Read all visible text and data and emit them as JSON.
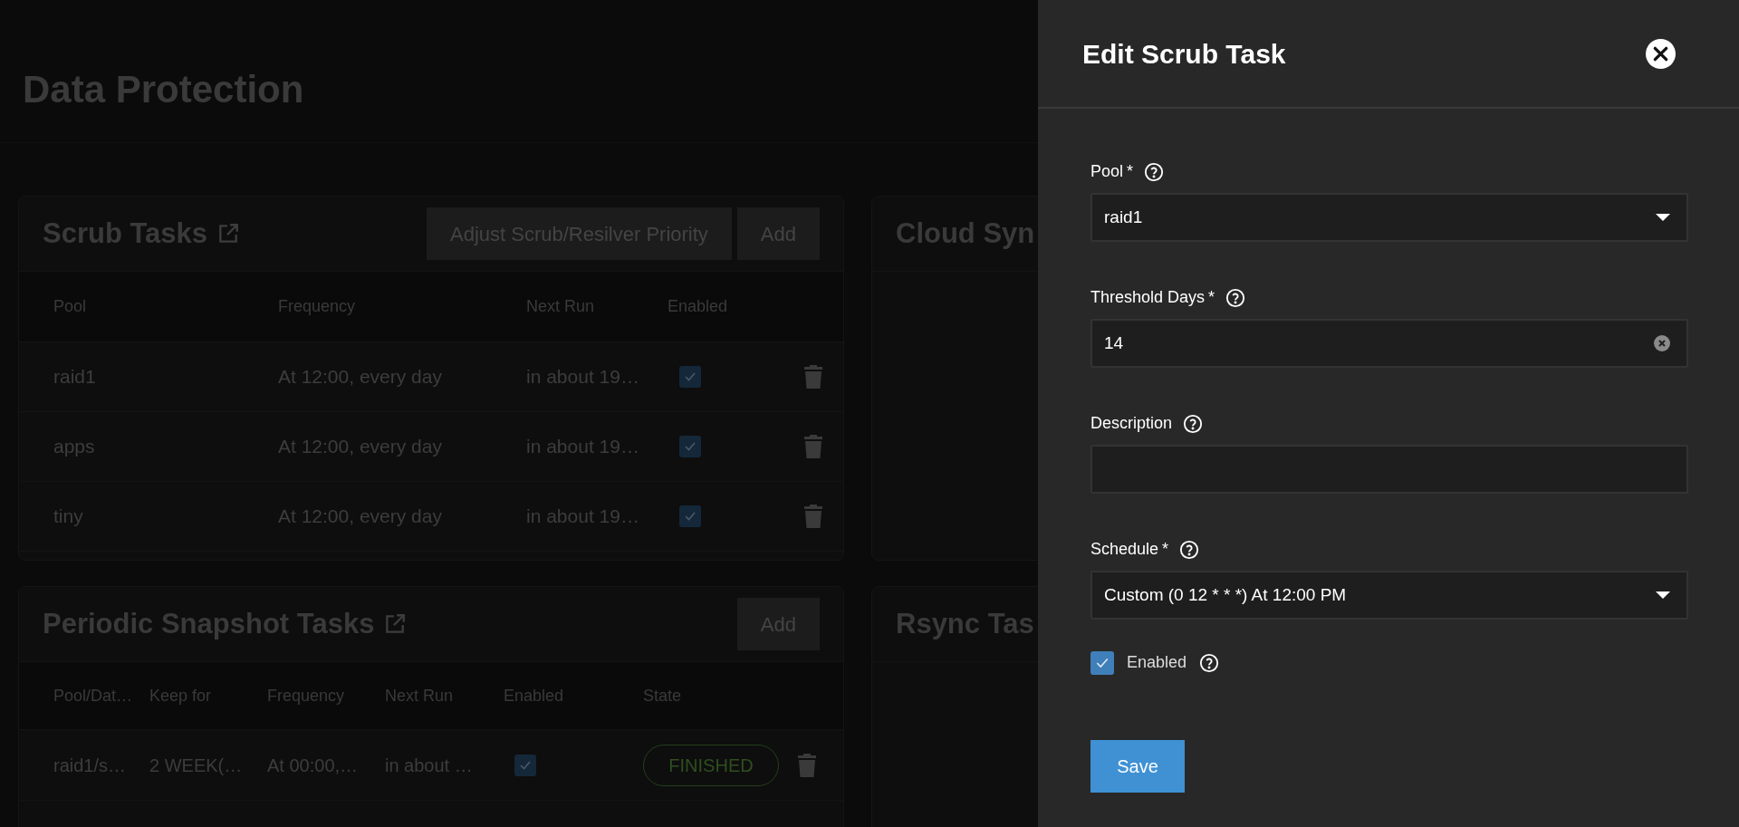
{
  "page": {
    "title": "Data Protection"
  },
  "scrub_tasks": {
    "title": "Scrub Tasks",
    "buttons": [
      "Adjust Scrub/Resilver Priority",
      "Add"
    ],
    "columns": [
      "Pool",
      "Frequency",
      "Next Run",
      "Enabled"
    ],
    "rows": [
      {
        "pool": "raid1",
        "frequency": "At 12:00, every day",
        "next_run": "in about 19…",
        "enabled": true
      },
      {
        "pool": "apps",
        "frequency": "At 12:00, every day",
        "next_run": "in about 19…",
        "enabled": true
      },
      {
        "pool": "tiny",
        "frequency": "At 12:00, every day",
        "next_run": "in about 19…",
        "enabled": true
      }
    ]
  },
  "snapshot_tasks": {
    "title": "Periodic Snapshot Tasks",
    "buttons": [
      "Add"
    ],
    "columns": [
      "Pool/Dat…",
      "Keep for",
      "Frequency",
      "Next Run",
      "Enabled",
      "State"
    ],
    "rows": [
      {
        "dataset": "raid1/s…",
        "keep_for": "2 WEEK(…",
        "frequency": "At 00:00,…",
        "next_run": "in about …",
        "enabled": true,
        "state": "FINISHED"
      }
    ]
  },
  "cloud_sync": {
    "title": "Cloud Syn"
  },
  "rsync": {
    "title": "Rsync Tas"
  },
  "drawer": {
    "title": "Edit Scrub Task",
    "fields": [
      {
        "kind": "select",
        "label": "Pool",
        "marker": "*",
        "value": "raid1"
      },
      {
        "kind": "text",
        "label": "Threshold Days",
        "marker": "*",
        "value": "14"
      },
      {
        "kind": "text",
        "label": "Description"
      },
      {
        "kind": "select",
        "label": "Schedule",
        "marker": "*",
        "value": "Custom (0 12 * * *) At 12:00 PM"
      }
    ],
    "enabled": {
      "label": "Enabled",
      "checked": true
    },
    "save": "Save"
  }
}
